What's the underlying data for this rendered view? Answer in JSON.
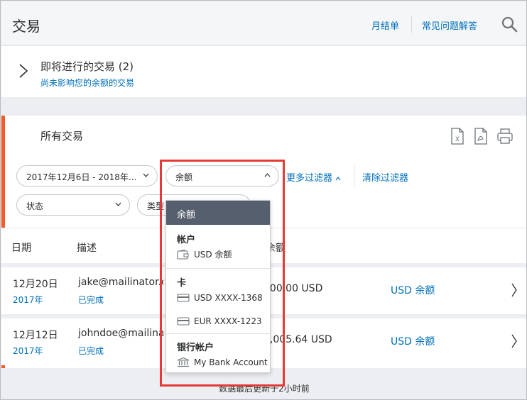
{
  "header": {
    "title": "交易",
    "statement_link": "月结单",
    "faq_link": "常见问题解答"
  },
  "pending": {
    "title": "即将进行的交易 (2)",
    "subtitle": "尚未影响您的余额的交易"
  },
  "transactions": {
    "title": "所有交易",
    "filters": {
      "date_range": "2017年12月6日 - 2018年...",
      "balance": "余额",
      "status": "状态",
      "type": "类型",
      "more_filters": "更多过滤器",
      "clear_filters": "清除过滤器"
    },
    "columns": {
      "date": "日期",
      "description": "描述",
      "amount": "余额"
    },
    "rows": [
      {
        "date": "12月20日",
        "year": "2017年",
        "name": "jake@mailinator.com",
        "status": "已完成",
        "amount": "500.00 USD",
        "source": "USD 余额"
      },
      {
        "date": "12月12日",
        "year": "2017年",
        "name": "johndoe@mailinator.com",
        "status": "已完成",
        "amount": "1,005.64 USD",
        "source": "USD 余额"
      }
    ]
  },
  "dropdown": {
    "selected": "余额",
    "groups": [
      {
        "label": "帐户",
        "items": [
          {
            "label": "USD 余额",
            "icon": "wallet-icon"
          }
        ]
      },
      {
        "label": "卡",
        "items": [
          {
            "label": "USD XXXX-1368",
            "icon": "card-icon"
          },
          {
            "label": "EUR XXXX-1223",
            "icon": "card-icon"
          }
        ]
      },
      {
        "label": "银行帐户",
        "items": [
          {
            "label": "My Bank Account",
            "icon": "bank-icon"
          }
        ]
      }
    ]
  },
  "footer": {
    "text": "数据最后更新于2小时前"
  },
  "colors": {
    "accent": "#f45b28",
    "link": "#0070ba",
    "dropdown_selected": "#565f6e",
    "highlight_box": "#e53935"
  }
}
